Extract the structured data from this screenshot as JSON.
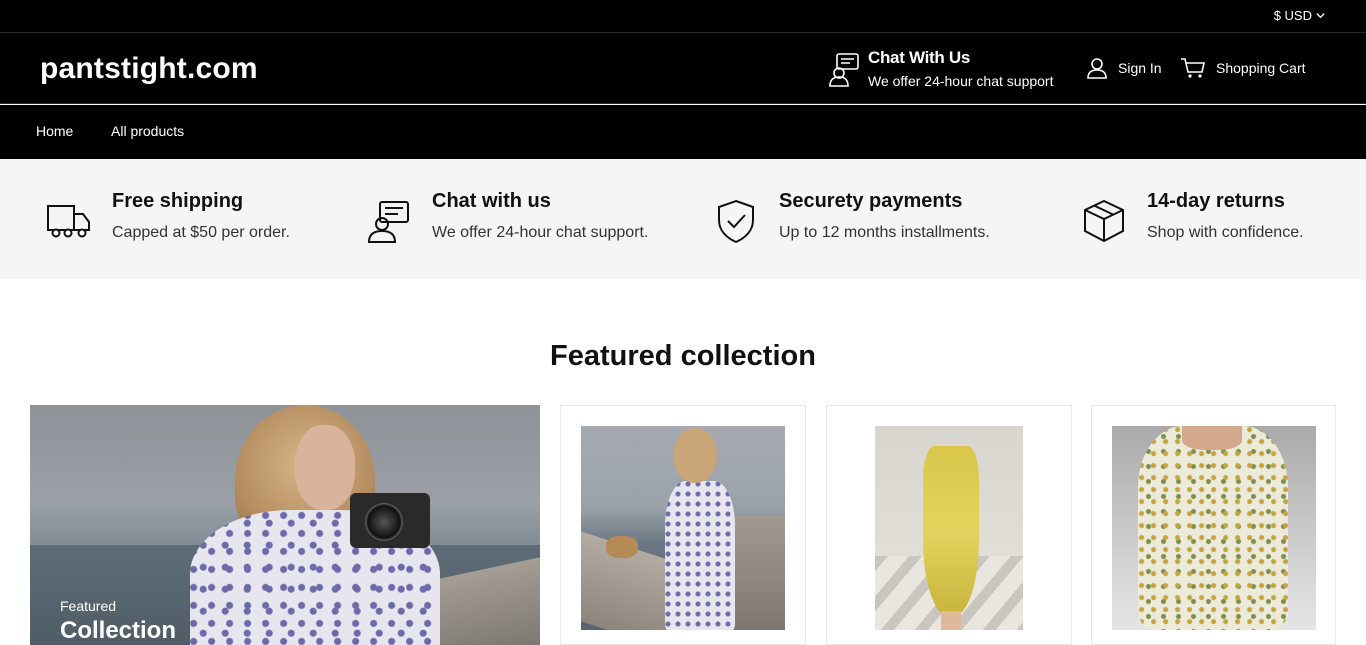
{
  "topbar": {
    "currency": "$ USD"
  },
  "header": {
    "logo": "pantstight.com",
    "chat_title": "Chat With Us",
    "chat_sub": "We offer 24-hour chat support",
    "signin": "Sign In",
    "cart": "Shopping Cart"
  },
  "nav": {
    "items": [
      {
        "label": "Home"
      },
      {
        "label": "All products"
      }
    ]
  },
  "features": [
    {
      "icon": "truck-icon",
      "title": "Free shipping",
      "sub": "Capped at $50 per order."
    },
    {
      "icon": "chat-support-icon",
      "title": "Chat with us",
      "sub": "We offer 24-hour chat support."
    },
    {
      "icon": "shield-check-icon",
      "title": "Securety payments",
      "sub": "Up to 12 months installments."
    },
    {
      "icon": "box-icon",
      "title": "14-day returns",
      "sub": "Shop with confidence."
    }
  ],
  "collection": {
    "title": "Featured collection",
    "hero_label": "Featured",
    "hero_title": "Collection"
  }
}
